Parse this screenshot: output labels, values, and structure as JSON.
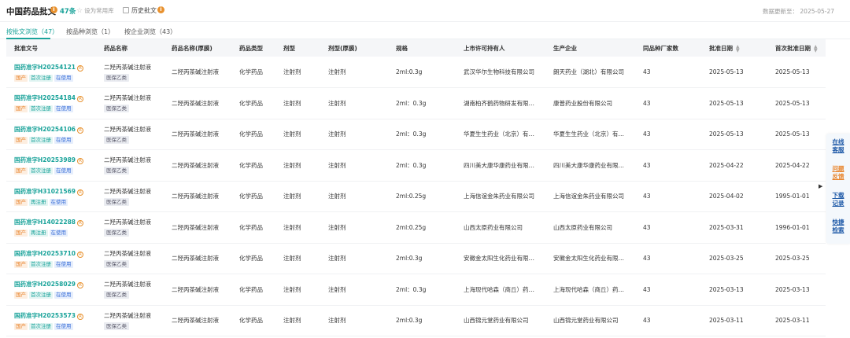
{
  "header": {
    "title": "中国药品批文",
    "info_icon": "i",
    "count": "47条",
    "favorite_label": "设为常用库",
    "history_label": "历史批文",
    "history_info_icon": "i",
    "update_text": "数据更新至： 2025-05-27"
  },
  "tabs": [
    {
      "label": "按批文浏览（47）",
      "active": true
    },
    {
      "label": "按品种浏览（1）",
      "active": false
    },
    {
      "label": "按企业浏览（43）",
      "active": false
    }
  ],
  "table": {
    "columns": [
      "批准文号",
      "药品名称",
      "药品名称(厚膜)",
      "药品类型",
      "剂型",
      "剂型(厚膜)",
      "规格",
      "上市许可持有人",
      "生产企业",
      "同品种厂家数",
      "批准日期",
      "首次批准日期"
    ],
    "rows": [
      {
        "approval": "国药准字H20254121",
        "tags": [
          "国产",
          "首次注册",
          "在使用"
        ],
        "name": "二羟丙茶碱注射液",
        "insurance": "医保乙类",
        "name2": "二羟丙茶碱注射液",
        "type": "化学药品",
        "form": "注射剂",
        "form2": "注射剂",
        "spec": "2ml:0.3g",
        "holder": "武汉华尔生物科技有限公司",
        "maker": "朗天药业（湖北）有限公司",
        "count": "43",
        "date": "2025-05-13",
        "first_date": "2025-05-13"
      },
      {
        "approval": "国药准字H20254184",
        "tags": [
          "国产",
          "首次注册",
          "在使用"
        ],
        "name": "二羟丙茶碱注射液",
        "insurance": "医保乙类",
        "name2": "二羟丙茶碱注射液",
        "type": "化学药品",
        "form": "注射剂",
        "form2": "注射剂",
        "spec": "2ml：0.3g",
        "holder": "湖南柏齐鹤药物研发有限…",
        "maker": "康普药业股份有限公司",
        "count": "43",
        "date": "2025-05-13",
        "first_date": "2025-05-13"
      },
      {
        "approval": "国药准字H20254106",
        "tags": [
          "国产",
          "首次注册",
          "在使用"
        ],
        "name": "二羟丙茶碱注射液",
        "insurance": "医保乙类",
        "name2": "二羟丙茶碱注射液",
        "type": "化学药品",
        "form": "注射剂",
        "form2": "注射剂",
        "spec": "2ml：0.3g",
        "holder": "华夏生生药业（北京）有…",
        "maker": "华夏生生药业（北京）有…",
        "count": "43",
        "date": "2025-05-13",
        "first_date": "2025-05-13"
      },
      {
        "approval": "国药准字H20253989",
        "tags": [
          "国产",
          "首次注册",
          "在使用"
        ],
        "name": "二羟丙茶碱注射液",
        "insurance": "医保乙类",
        "name2": "二羟丙茶碱注射液",
        "type": "化学药品",
        "form": "注射剂",
        "form2": "注射剂",
        "spec": "2ml：0.3g",
        "holder": "四川美大康华康药业有限…",
        "maker": "四川美大康华康药业有限…",
        "count": "43",
        "date": "2025-04-22",
        "first_date": "2025-04-22"
      },
      {
        "approval": "国药准字H31021569",
        "tags": [
          "国产",
          "再注册",
          "在使用"
        ],
        "name": "二羟丙茶碱注射液",
        "insurance": "医保乙类",
        "name2": "二羟丙茶碱注射液",
        "type": "化学药品",
        "form": "注射剂",
        "form2": "注射剂",
        "spec": "2ml:0.25g",
        "holder": "上海信谊金朱药业有限公司",
        "maker": "上海信谊金朱药业有限公司",
        "count": "43",
        "date": "2025-04-02",
        "first_date": "1995-01-01"
      },
      {
        "approval": "国药准字H14022288",
        "tags": [
          "国产",
          "再注册",
          "在使用"
        ],
        "name": "二羟丙茶碱注射液",
        "insurance": "医保乙类",
        "name2": "二羟丙茶碱注射液",
        "type": "化学药品",
        "form": "注射剂",
        "form2": "注射剂",
        "spec": "2ml:0.25g",
        "holder": "山西太原药业有限公司",
        "maker": "山西太原药业有限公司",
        "count": "43",
        "date": "2025-03-31",
        "first_date": "1996-01-01"
      },
      {
        "approval": "国药准字H20253710",
        "tags": [
          "国产",
          "首次注册",
          "在使用"
        ],
        "name": "二羟丙茶碱注射液",
        "insurance": "医保乙类",
        "name2": "二羟丙茶碱注射液",
        "type": "化学药品",
        "form": "注射剂",
        "form2": "注射剂",
        "spec": "2ml:0.3g",
        "holder": "安徽金太阳生化药业有限…",
        "maker": "安徽金太阳生化药业有限…",
        "count": "43",
        "date": "2025-03-25",
        "first_date": "2025-03-25"
      },
      {
        "approval": "国药准字H20258029",
        "tags": [
          "国产",
          "首次注册",
          "在使用"
        ],
        "name": "二羟丙茶碱注射液",
        "insurance": "医保乙类",
        "name2": "二羟丙茶碱注射液",
        "type": "化学药品",
        "form": "注射剂",
        "form2": "注射剂",
        "spec": "2ml：0.3g",
        "holder": "上海现代哈森（商丘）药…",
        "maker": "上海现代哈森（商丘）药…",
        "count": "43",
        "date": "2025-03-13",
        "first_date": "2025-03-13"
      },
      {
        "approval": "国药准字H20253573",
        "tags": [
          "国产",
          "首次注册",
          "在使用"
        ],
        "name": "二羟丙茶碱注射液",
        "insurance": "医保乙类",
        "name2": "二羟丙茶碱注射液",
        "type": "化学药品",
        "form": "注射剂",
        "form2": "注射剂",
        "spec": "2ml:0.3g",
        "holder": "山西锦元堂药业有限公司",
        "maker": "山西锦元堂药业有限公司",
        "count": "43",
        "date": "2025-03-11",
        "first_date": "2025-03-11"
      }
    ]
  },
  "side_panel": {
    "arrow": "▶",
    "buttons": [
      {
        "line1": "在线",
        "line2": "客服",
        "color": "#1f5aa8"
      },
      {
        "line1": "问题",
        "line2": "反馈",
        "color": "#e8832a"
      },
      {
        "line1": "下载",
        "line2": "记录",
        "color": "#1f5aa8"
      },
      {
        "line1": "快捷",
        "line2": "检索",
        "color": "#1f5aa8"
      }
    ]
  },
  "colors": {
    "accent": "#1aa39a",
    "warning": "#e8912e",
    "side_text": "#1f5aa8"
  }
}
